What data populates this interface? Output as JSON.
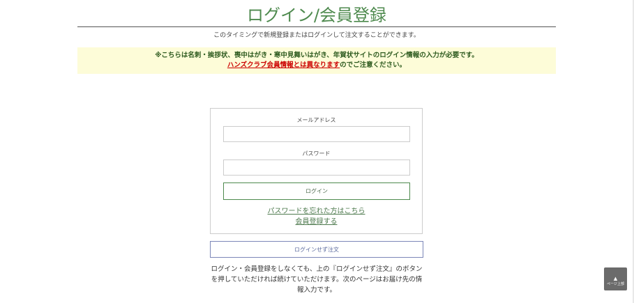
{
  "header": {
    "title": "ログイン/会員登録",
    "intro": "このタイミングで新規登録またはログインして注文することができます。"
  },
  "notice": {
    "line1": "※こちらは名刺・挨拶状、喪中はがき・寒中見舞いはがき、年賀状サイトのログイン情報の入力が必要です。",
    "link_text": "ハンズクラブ会員情報とは異なります",
    "line2_suffix": "のでご注意ください。",
    "link_color": "#cc0000",
    "text_color": "#2d5a1e",
    "background": "#fdfcd8"
  },
  "login_form": {
    "email_label": "メールアドレス",
    "email_value": "",
    "password_label": "パスワード",
    "password_value": "",
    "login_button": "ログイン",
    "forgot_password_link": "パスワードを忘れた方はこちら",
    "register_link": "会員登録する",
    "accent_color": "#4e8a4e"
  },
  "guest": {
    "button_label": "ログインせず注文",
    "note": "ログイン・会員登録をしなくても、上の『ログインせず注文』のボタンを押していただければ続けていただけます。次のページはお届け先の情報入力です。",
    "border_color": "#7b86b8"
  },
  "page_top": {
    "arrow": "▲",
    "label": "ページ上部",
    "icon": "up-arrow-icon"
  }
}
